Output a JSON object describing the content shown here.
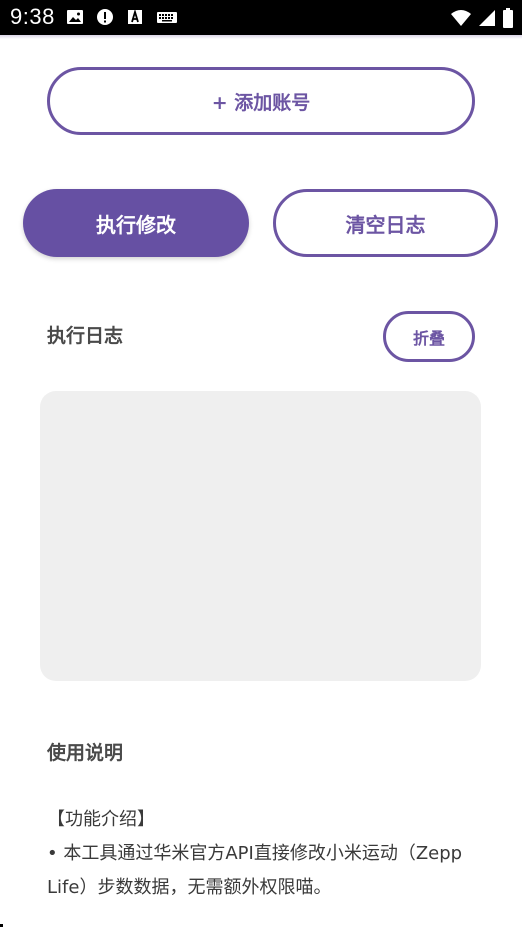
{
  "status_bar": {
    "time": "9:38",
    "left_icons": [
      "gallery-icon",
      "alert-icon",
      "font-a-icon",
      "keyboard-icon"
    ],
    "right_icons": [
      "wifi-icon",
      "signal-icon",
      "battery-icon"
    ]
  },
  "buttons": {
    "add_account": "+ 添加账号",
    "execute": "执行修改",
    "clear_log": "清空日志",
    "collapse": "折叠"
  },
  "log": {
    "title": "执行日志",
    "content": ""
  },
  "usage": {
    "title": "使用说明",
    "heading": "【功能介绍】",
    "line1": "• 本工具通过华米官方API直接修改小米运动（Zepp",
    "line2": "Life）步数数据，无需额外权限喵。"
  },
  "colors": {
    "accent": "#6650a3",
    "outline": "#6c55a3",
    "log_bg": "#efefef",
    "status_bar": "#000000"
  }
}
